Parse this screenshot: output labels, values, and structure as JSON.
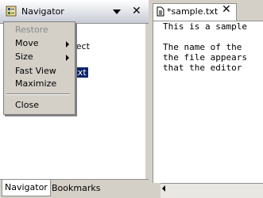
{
  "navigator": {
    "title": "Navigator",
    "tree": [
      {
        "label": "oject"
      },
      {
        "label": "t"
      },
      {
        "label": ".txt",
        "selected": true
      }
    ],
    "tabs": {
      "navigator": "Navigator",
      "bookmarks": "Bookmarks"
    }
  },
  "context_menu": {
    "items": {
      "restore": "Restore",
      "move": "Move",
      "size": "Size",
      "fastview": "Fast View",
      "maximize": "Maximize",
      "close": "Close"
    },
    "disabled_color": "#8a8a8a"
  },
  "editor": {
    "tab_label": "*sample.txt",
    "lines": [
      "This is a sample",
      "",
      "The name of the",
      "the file appears",
      "that the editor"
    ]
  },
  "icons": {
    "app": "navigator-app-icon",
    "menu": "view-menu-down-triangle-icon",
    "close": "close-icon",
    "file": "text-file-icon"
  },
  "colors": {
    "selection": "#0a246a",
    "chrome": "#d4d0c8"
  }
}
